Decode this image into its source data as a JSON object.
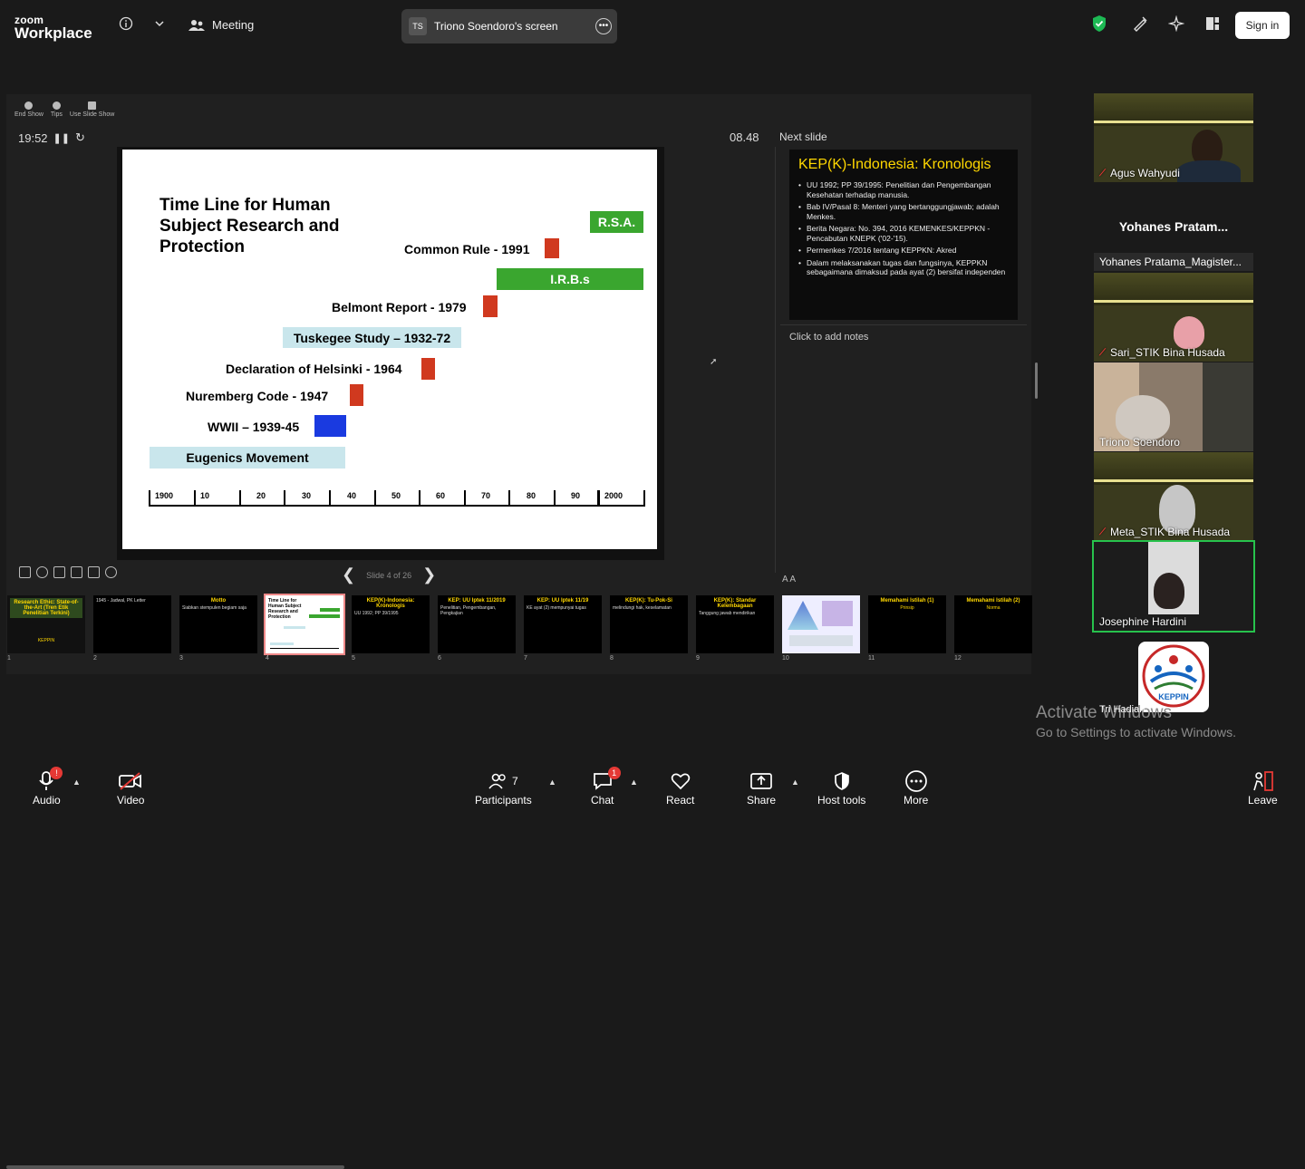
{
  "topbar": {
    "logo_line1": "zoom",
    "logo_line2": "Workplace",
    "meeting_label": "Meeting",
    "share_badge": "TS",
    "share_title": "Triono Soendoro's screen",
    "signin_label": "Sign in",
    "colors": {
      "shield": "#1db954",
      "signin_bg": "#ffffff"
    }
  },
  "presenter": {
    "tools": [
      "End Show",
      "Tips",
      "Use Slide Show"
    ],
    "elapsed": "19:52",
    "clock": "08.48",
    "next_slide_label": "Next slide",
    "notes_placeholder": "Click to add notes",
    "slide_counter": "Slide 4 of 26",
    "font_controls": "A A"
  },
  "current_slide": {
    "title": "Time Line for Human Subject Research and Protection",
    "events": [
      {
        "label": "R.S.A."
      },
      {
        "label": "Common Rule - 1991"
      },
      {
        "label": "I.R.B.s"
      },
      {
        "label": "Belmont Report - 1979"
      },
      {
        "label": "Tuskegee Study – 1932-72"
      },
      {
        "label": "Declaration of Helsinki - 1964"
      },
      {
        "label": "Nuremberg Code - 1947"
      },
      {
        "label": "WWII – 1939-45"
      },
      {
        "label": "Eugenics Movement"
      }
    ],
    "axis_ticks": [
      "1900",
      "10",
      "20",
      "30",
      "40",
      "50",
      "60",
      "70",
      "80",
      "90",
      "2000"
    ]
  },
  "next_slide": {
    "title": "KEP(K)-Indonesia: Kronologis",
    "bullets": [
      "UU 1992; PP 39/1995: Penelitian dan Pengembangan Kesehatan terhadap manusia.",
      "Bab IV/Pasal 8: Menteri yang bertanggungjawab; adalah Menkes.",
      "Berita Negara: No. 394, 2016 KEMENKES/KEPPKN - Pencabutan KNEPK ('02-'15).",
      "Permenkes 7/2016 tentang KEPPKN: Akred",
      "Dalam melaksanakan tugas dan fungsinya, KEPPKN sebagaimana dimaksud pada ayat (2) bersifat independen"
    ]
  },
  "thumbnails": [
    {
      "num": "1",
      "title": "Research Ethic: State-of-the-Art (Tren Etik Penelitian Terkini)",
      "sub": "KEPPIN",
      "dark": true
    },
    {
      "num": "2",
      "title": "",
      "sub": "1945 - Jadwal, PK Letter",
      "dark": true
    },
    {
      "num": "3",
      "title": "Motto",
      "sub": "Siabkan stempulen begiam saja",
      "dark": true
    },
    {
      "num": "4",
      "title": "Time Line for Human Subject Research and Protection",
      "sub": "",
      "dark": false,
      "selected": true
    },
    {
      "num": "5",
      "title": "KEP(K)-Indonesia: Kronologis",
      "sub": "UU 1992; PP 39/1995",
      "dark": true
    },
    {
      "num": "6",
      "title": "KEP: UU Iptek 11/2019",
      "sub": "Penelitian, Pengembangan, Pengkajian",
      "dark": true
    },
    {
      "num": "7",
      "title": "KEP: UU Iptek 11/19",
      "sub": "KE ayat (2) mempunyai tugas",
      "dark": true
    },
    {
      "num": "8",
      "title": "KEP(K): Tu-Pok-Si",
      "sub": "melindungi hak, keselamatan",
      "dark": true
    },
    {
      "num": "9",
      "title": "KEP(K): Standar Kelembagaan",
      "sub": "Tanggung jawab mendirikan",
      "dark": true
    },
    {
      "num": "10",
      "title": "",
      "sub": "",
      "dark": false
    },
    {
      "num": "11",
      "title": "Memahami Istilah (1)",
      "sub": "Prinsip",
      "dark": true
    },
    {
      "num": "12",
      "title": "Memahami Istilah (2)",
      "sub": "Norma",
      "dark": true
    }
  ],
  "participants": [
    {
      "name": "Agus Wahyudi",
      "muted": true
    },
    {
      "name": "Yohanes  Pratam...",
      "name_only": true
    },
    {
      "name": "Yohanes Pratama_Magister...",
      "tag": true
    },
    {
      "name": "Sari_STIK Bina Husada",
      "muted": true
    },
    {
      "name": "Triono Soendoro",
      "muted": false
    },
    {
      "name": "Meta_STIK Bina Husada",
      "muted": true
    },
    {
      "name": "Josephine Hardini",
      "muted": false,
      "active": true
    },
    {
      "name": "Tri Hadiah",
      "logo": "KEPPIN"
    }
  ],
  "watermark": {
    "line1": "Activate Windows",
    "line2": "Go to Settings to activate Windows."
  },
  "bottombar": {
    "audio": "Audio",
    "video": "Video",
    "participants": "Participants",
    "participants_count": "7",
    "chat": "Chat",
    "chat_badge": "1",
    "audio_badge": "!",
    "react": "React",
    "share": "Share",
    "host_tools": "Host tools",
    "more": "More",
    "leave": "Leave"
  }
}
